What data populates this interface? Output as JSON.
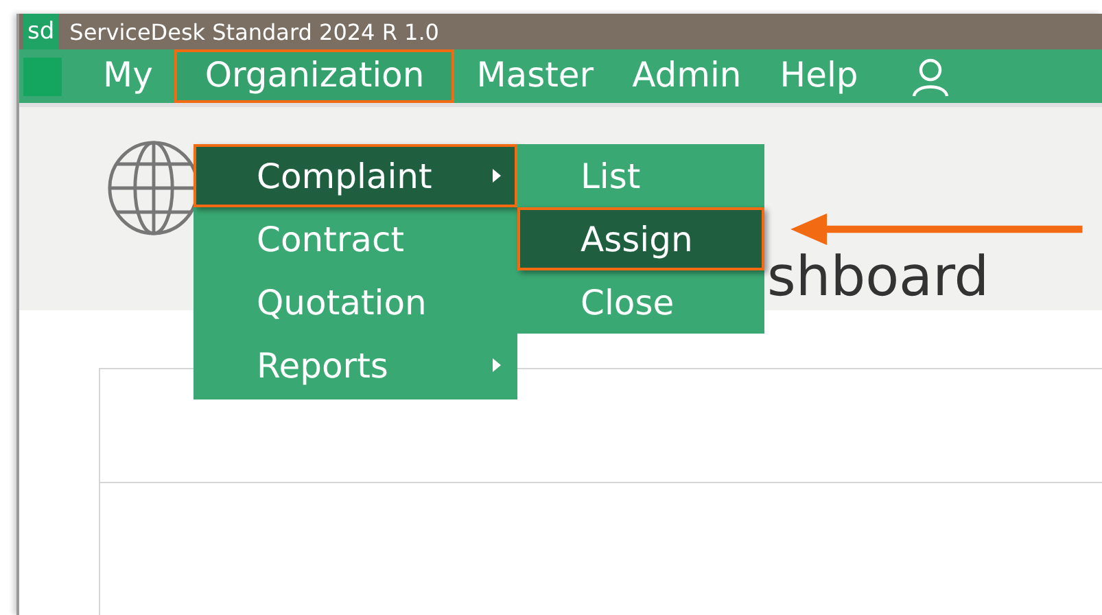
{
  "window": {
    "app_icon": "sd",
    "title": "ServiceDesk Standard 2024 R 1.0"
  },
  "menubar": {
    "items": [
      {
        "label": "My",
        "selected": false
      },
      {
        "label": "Organization",
        "selected": true
      },
      {
        "label": "Master",
        "selected": false
      },
      {
        "label": "Admin",
        "selected": false
      },
      {
        "label": "Help",
        "selected": false
      }
    ]
  },
  "dropdown": {
    "items": [
      {
        "label": "Complaint",
        "selected": true,
        "has_submenu": true
      },
      {
        "label": "Contract",
        "selected": false,
        "has_submenu": false
      },
      {
        "label": "Quotation",
        "selected": false,
        "has_submenu": false
      },
      {
        "label": "Reports",
        "selected": false,
        "has_submenu": true
      }
    ]
  },
  "submenu": {
    "items": [
      {
        "label": "List",
        "selected": false
      },
      {
        "label": "Assign",
        "selected": true
      },
      {
        "label": "Close",
        "selected": false
      }
    ]
  },
  "page": {
    "title": "shboard"
  }
}
